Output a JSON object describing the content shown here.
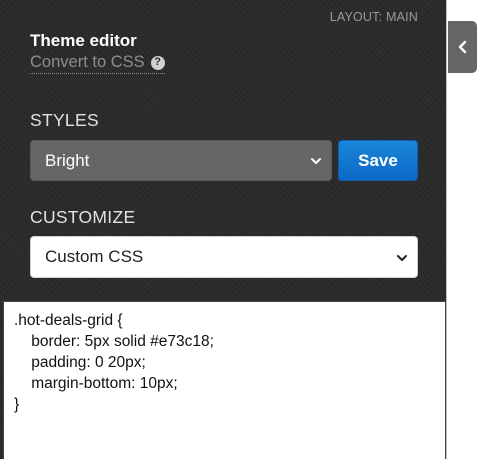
{
  "panel": {
    "layout_label": "LAYOUT: MAIN",
    "title": "Theme editor",
    "convert_link": "Convert to CSS",
    "help_icon": "?"
  },
  "styles": {
    "label": "STYLES",
    "selected": "Bright",
    "save_label": "Save"
  },
  "customize": {
    "label": "CUSTOMIZE",
    "selected": "Custom CSS"
  },
  "editor": {
    "lines": [
      ".hot-deals-grid {",
      "    border: 5px solid #e73c18;",
      "    padding: 0 20px;",
      "    margin-bottom: 10px;",
      "}"
    ]
  },
  "collapse_tab": {
    "icon": "chevron-left-icon"
  },
  "colors": {
    "panel_bg": "#2b2b2b",
    "save_button": "#1a86db",
    "dark_select": "#666666"
  }
}
